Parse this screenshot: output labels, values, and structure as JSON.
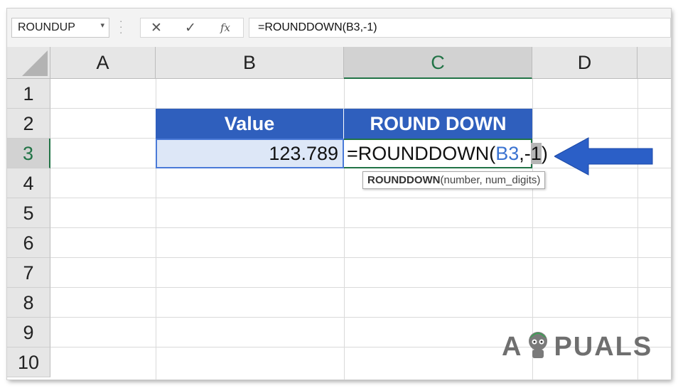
{
  "formula_bar": {
    "name_box": "ROUNDUP",
    "cancel_icon": "✕",
    "enter_icon": "✓",
    "fx_label": "fx",
    "formula": "=ROUNDDOWN(B3,-1)"
  },
  "columns": [
    "A",
    "B",
    "C",
    "D"
  ],
  "rows": [
    "1",
    "2",
    "3",
    "4",
    "5",
    "6",
    "7",
    "8",
    "9",
    "10"
  ],
  "table": {
    "header_value": "Value",
    "header_round_down": "ROUND DOWN",
    "value": "123.789",
    "edit_prefix": "=ROUNDDOWN(",
    "edit_ref": "B3",
    "edit_mid": ",-",
    "edit_cursor": "1",
    "edit_suffix": ")"
  },
  "tooltip": {
    "function": "ROUNDDOWN",
    "args": "(number, num_digits)"
  },
  "watermark": {
    "part1": "A",
    "part2": "PUALS"
  },
  "colors": {
    "header_blue": "#2f5fbd",
    "excel_green": "#217346",
    "arrow_blue": "#2b5fc7"
  }
}
